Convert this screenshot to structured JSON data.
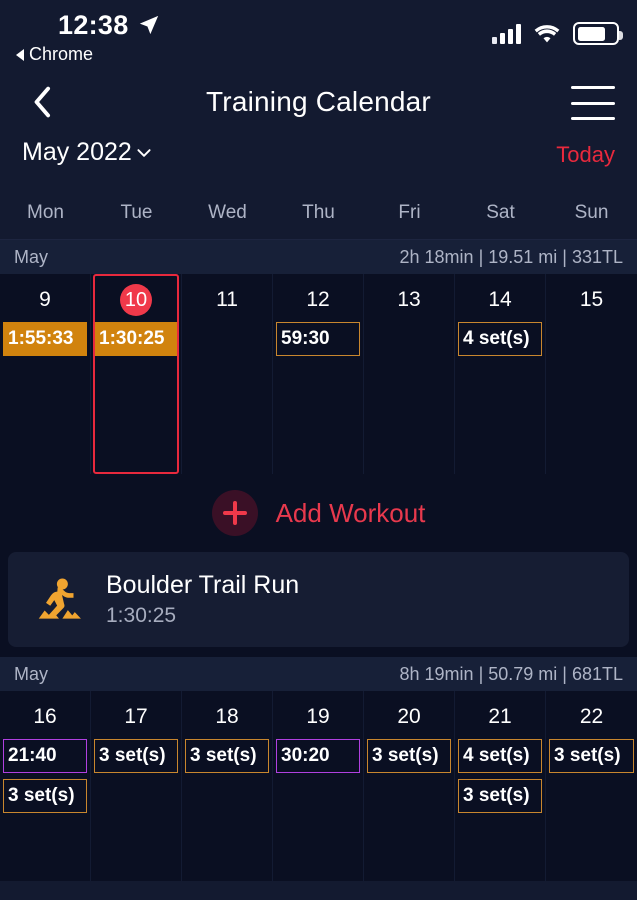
{
  "statusbar": {
    "time": "12:38",
    "back_app": "Chrome",
    "location_icon": "location-arrow-icon",
    "signal_icon": "cellular-signal-icon",
    "wifi_icon": "wifi-icon",
    "battery_icon": "battery-icon"
  },
  "navbar": {
    "back_icon": "chevron-left-icon",
    "title": "Training Calendar",
    "menu_icon": "hamburger-menu-icon"
  },
  "month": {
    "label": "May 2022",
    "chevron_icon": "chevron-down-icon",
    "today_label": "Today"
  },
  "weekdays": [
    "Mon",
    "Tue",
    "Wed",
    "Thu",
    "Fri",
    "Sat",
    "Sun"
  ],
  "colors": {
    "accent_red": "#e8293d",
    "selected_red": "#f0394a",
    "chip_orange_fill": "#d1830e",
    "chip_orange_border": "#c8862e",
    "chip_purple_border": "#b040e0",
    "icon_orange": "#f0a430",
    "page_bg": "#0a0f22",
    "header_bg": "#131a30",
    "band_bg": "#172038",
    "card_bg": "#161d33"
  },
  "weeks": [
    {
      "month_label": "May",
      "summary": "2h 18min | 19.51 mi | 331TL",
      "days": [
        {
          "num": "9",
          "selected": false,
          "chips": [
            {
              "text": "1:55:33",
              "style": "filled-orange"
            }
          ]
        },
        {
          "num": "10",
          "selected": true,
          "chips": [
            {
              "text": "1:30:25",
              "style": "filled-orange"
            }
          ]
        },
        {
          "num": "11",
          "selected": false,
          "chips": []
        },
        {
          "num": "12",
          "selected": false,
          "chips": [
            {
              "text": "59:30",
              "style": "out-orange"
            }
          ]
        },
        {
          "num": "13",
          "selected": false,
          "chips": []
        },
        {
          "num": "14",
          "selected": false,
          "chips": [
            {
              "text": "4 set(s)",
              "style": "out-orange"
            }
          ]
        },
        {
          "num": "15",
          "selected": false,
          "chips": []
        }
      ]
    },
    {
      "month_label": "May",
      "summary": "8h 19min | 50.79 mi | 681TL",
      "days": [
        {
          "num": "16",
          "selected": false,
          "chips": [
            {
              "text": "21:40",
              "style": "out-purple"
            },
            {
              "text": "3 set(s)",
              "style": "out-orange"
            }
          ]
        },
        {
          "num": "17",
          "selected": false,
          "chips": [
            {
              "text": "3 set(s)",
              "style": "out-orange"
            }
          ]
        },
        {
          "num": "18",
          "selected": false,
          "chips": [
            {
              "text": "3 set(s)",
              "style": "out-orange"
            }
          ]
        },
        {
          "num": "19",
          "selected": false,
          "chips": [
            {
              "text": "30:20",
              "style": "out-purple"
            }
          ]
        },
        {
          "num": "20",
          "selected": false,
          "chips": [
            {
              "text": "3 set(s)",
              "style": "out-orange"
            }
          ]
        },
        {
          "num": "21",
          "selected": false,
          "chips": [
            {
              "text": "4 set(s)",
              "style": "out-orange"
            },
            {
              "text": "3 set(s)",
              "style": "out-orange"
            }
          ]
        },
        {
          "num": "22",
          "selected": false,
          "chips": [
            {
              "text": "3 set(s)",
              "style": "out-orange"
            }
          ]
        }
      ]
    }
  ],
  "add_workout": {
    "label": "Add Workout",
    "icon": "plus-icon"
  },
  "workout_card": {
    "icon": "trail-running-icon",
    "title": "Boulder Trail Run",
    "duration": "1:30:25"
  }
}
